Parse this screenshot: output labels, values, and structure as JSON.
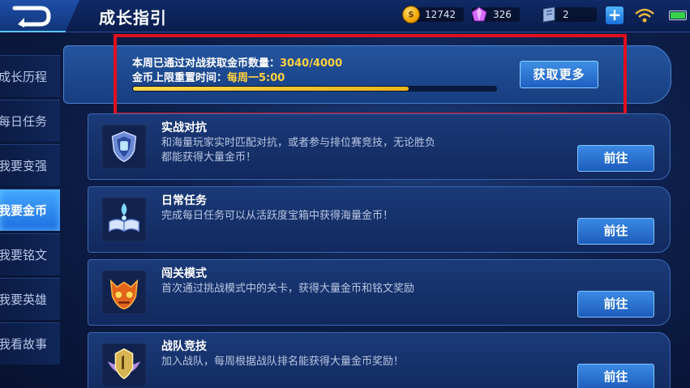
{
  "header": {
    "title": "成长指引",
    "back_icon": "back-arrow-icon",
    "resources": {
      "gold": "12742",
      "diamond": "326",
      "ticket": "2"
    },
    "add_icon": "plus-icon",
    "signal_icon": "wifi-icon",
    "battery_icon": "battery-icon"
  },
  "sidebar": {
    "items": [
      {
        "label": "成长历程",
        "active": false
      },
      {
        "label": "每日任务",
        "active": false
      },
      {
        "label": "我要变强",
        "active": false
      },
      {
        "label": "我要金币",
        "active": true
      },
      {
        "label": "我要铭文",
        "active": false
      },
      {
        "label": "我要英雄",
        "active": false
      },
      {
        "label": "我看故事",
        "active": false
      }
    ]
  },
  "banner": {
    "line1_label": "本周已通过对战获取金币数量：",
    "line1_value": "3040/4000",
    "line2_label": "金币上限重置时间：",
    "line2_value": "每周一5:00",
    "progress_fraction": 0.76,
    "button_label": "获取更多"
  },
  "cards": [
    {
      "title": "实战对抗",
      "desc": "和海量玩家实时匹配对抗，或者参与排位赛竞技，无论胜负都能获得大量金币！",
      "button": "前往",
      "icon": "shield-trophy-icon"
    },
    {
      "title": "日常任务",
      "desc": "完成每日任务可以从活跃度宝箱中获得海量金币！",
      "button": "前往",
      "icon": "open-book-icon"
    },
    {
      "title": "闯关模式",
      "desc": "首次通过挑战模式中的关卡，获得大量金币和铭文奖励",
      "button": "前往",
      "icon": "demon-mask-icon"
    },
    {
      "title": "战队竞技",
      "desc": "加入战队，每周根据战队排名能获得大量金币奖励！",
      "button": "前往",
      "icon": "winged-badge-icon"
    }
  ],
  "colors": {
    "accent": "#ffd23f",
    "highlight_frame": "#e0101e",
    "button_blue": "#1d5cbc"
  }
}
